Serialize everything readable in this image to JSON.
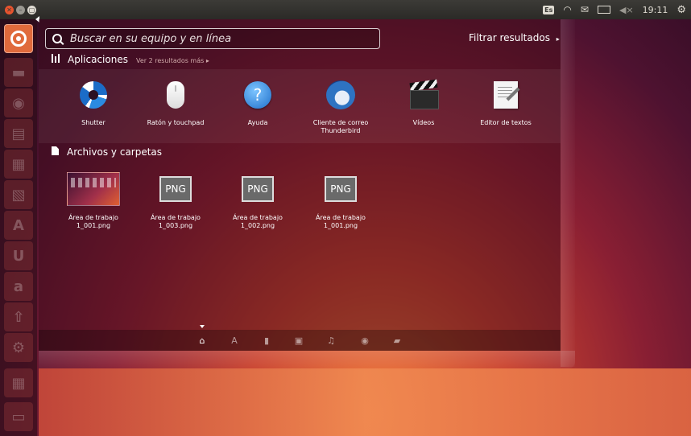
{
  "top_panel": {
    "keyboard_layout": "Es",
    "time": "19:11"
  },
  "search": {
    "placeholder": "Buscar en su equipo y en línea",
    "filter_label": "Filtrar resultados"
  },
  "applications": {
    "title": "Aplicaciones",
    "more_results": "Ver 2 resultados más",
    "items": [
      {
        "label": "Shutter",
        "icon": "shutter-icon"
      },
      {
        "label": "Ratón y touchpad",
        "icon": "mouse-icon"
      },
      {
        "label": "Ayuda",
        "icon": "help-icon",
        "glyph": "?"
      },
      {
        "label": "Cliente de correo Thunderbird",
        "icon": "thunderbird-icon"
      },
      {
        "label": "Vídeos",
        "icon": "videos-icon"
      },
      {
        "label": "Editor de textos",
        "icon": "text-editor-icon"
      }
    ]
  },
  "files": {
    "title": "Archivos y carpetas",
    "thumb_text": "PNG",
    "items": [
      {
        "label": "Área de trabajo 1_001.png",
        "icon": "screenshot-thumbnail"
      },
      {
        "label": "Área de trabajo 1_003.png",
        "icon": "png-file-icon"
      },
      {
        "label": "Área de trabajo 1_002.png",
        "icon": "png-file-icon"
      },
      {
        "label": "Área de trabajo 1_001.png",
        "icon": "png-file-icon"
      }
    ]
  },
  "lenses": [
    {
      "name": "home-lens-icon",
      "active": true
    },
    {
      "name": "applications-lens-icon",
      "active": false
    },
    {
      "name": "files-lens-icon",
      "active": false
    },
    {
      "name": "video-lens-icon",
      "active": false
    },
    {
      "name": "music-lens-icon",
      "active": false
    },
    {
      "name": "photo-lens-icon",
      "active": false
    },
    {
      "name": "social-lens-icon",
      "active": false
    }
  ],
  "colors": {
    "panel": "#3c3b37",
    "launcher_home": "#e06a3c",
    "close_button": "#e6542e"
  }
}
